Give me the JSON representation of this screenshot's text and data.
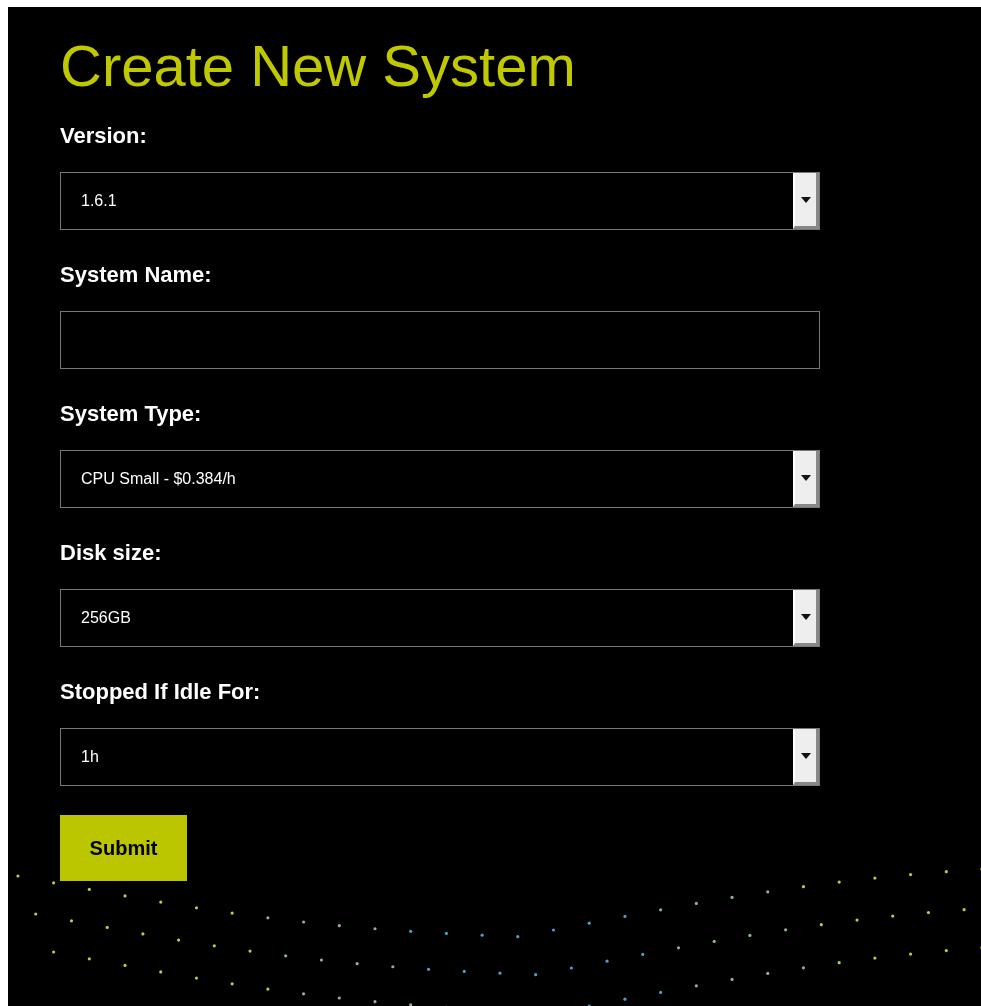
{
  "title": "Create New System",
  "fields": [
    {
      "label": "Version:",
      "kind": "select",
      "value": "1.6.1"
    },
    {
      "label": "System Name:",
      "kind": "text"
    },
    {
      "label": "System Type:",
      "kind": "select",
      "value": "CPU Small - $0.384/h"
    },
    {
      "label": "Disk size:",
      "kind": "select",
      "value": "256GB"
    },
    {
      "label": "Stopped If Idle For:",
      "kind": "select",
      "value": "1h"
    }
  ],
  "submit": "Submit"
}
